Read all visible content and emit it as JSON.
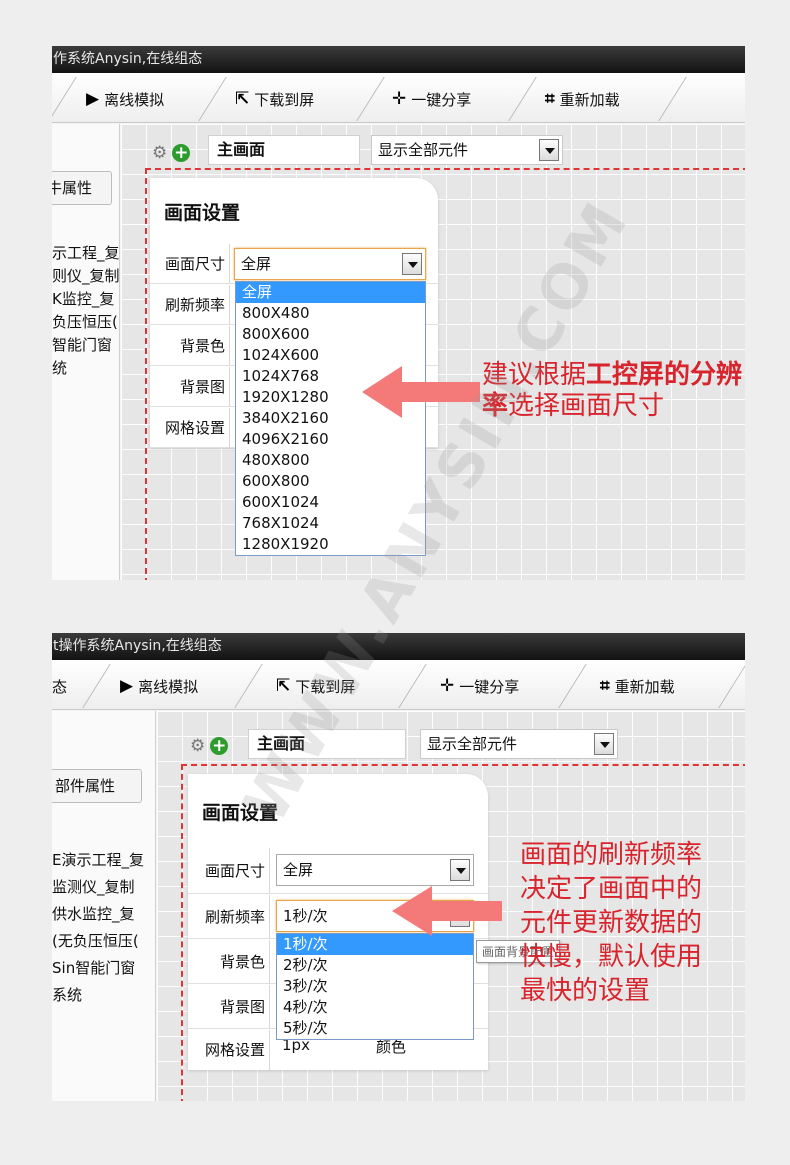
{
  "app_title_1": "作系统Anysin,在线组态",
  "app_title_2": "t操作系统Anysin,在线组态",
  "toolbar": {
    "offline_sim": "离线模拟",
    "download": "下载到屏",
    "share": "一键分享",
    "reload": "重新加载",
    "partial_left": "态"
  },
  "left_tab_1": "牛属性",
  "left_tab_2": "部件属性",
  "tree_1": [
    "示工程_复",
    "则仪_复制",
    "K监控_复",
    "负压恒压(",
    "智能门窗",
    "统"
  ],
  "tree_2": [
    "E演示工程_复",
    "监测仪_复制",
    "供水监控_复",
    "(无负压恒压(",
    "Sin智能门窗",
    "系统"
  ],
  "page_name": "主画面",
  "show_select": "显示全部元件",
  "panel": {
    "title": "画面设置",
    "size_label": "画面尺寸",
    "refresh_label": "刷新频率",
    "bg_color_label": "背景色",
    "bg_image_label": "背景图",
    "grid_label": "网格设置",
    "size_value": "全屏",
    "refresh_value": "1秒/次",
    "grid_value": "1px",
    "grid_color": "颜色"
  },
  "size_options": [
    "全屏",
    "800X480",
    "800X600",
    "1024X600",
    "1024X768",
    "1920X1280",
    "3840X2160",
    "4096X2160",
    "480X800",
    "600X800",
    "600X1024",
    "768X1024",
    "1280X1920"
  ],
  "refresh_options": [
    "1秒/次",
    "2秒/次",
    "3秒/次",
    "4秒/次",
    "5秒/次"
  ],
  "tooltip": "画面背景配置",
  "callout_1": {
    "pre": "建议根据",
    "bold": "工控屏的分辨率",
    "post": "选择画面尺寸"
  },
  "callout_2": [
    "画面的刷新频率",
    "决定了画面中的",
    "元件更新数据的",
    "快慢，默认使用",
    "最快的设置"
  ],
  "watermark": "WWW.ANYSIN.COM",
  "colors": {
    "accent_red": "#d8242c",
    "arrow": "#f47a7a",
    "selected": "#3399ff"
  },
  "icons": [
    "play-icon",
    "export-icon",
    "share-target-icon",
    "reload-frame-icon",
    "gear-icon",
    "plus-icon"
  ]
}
